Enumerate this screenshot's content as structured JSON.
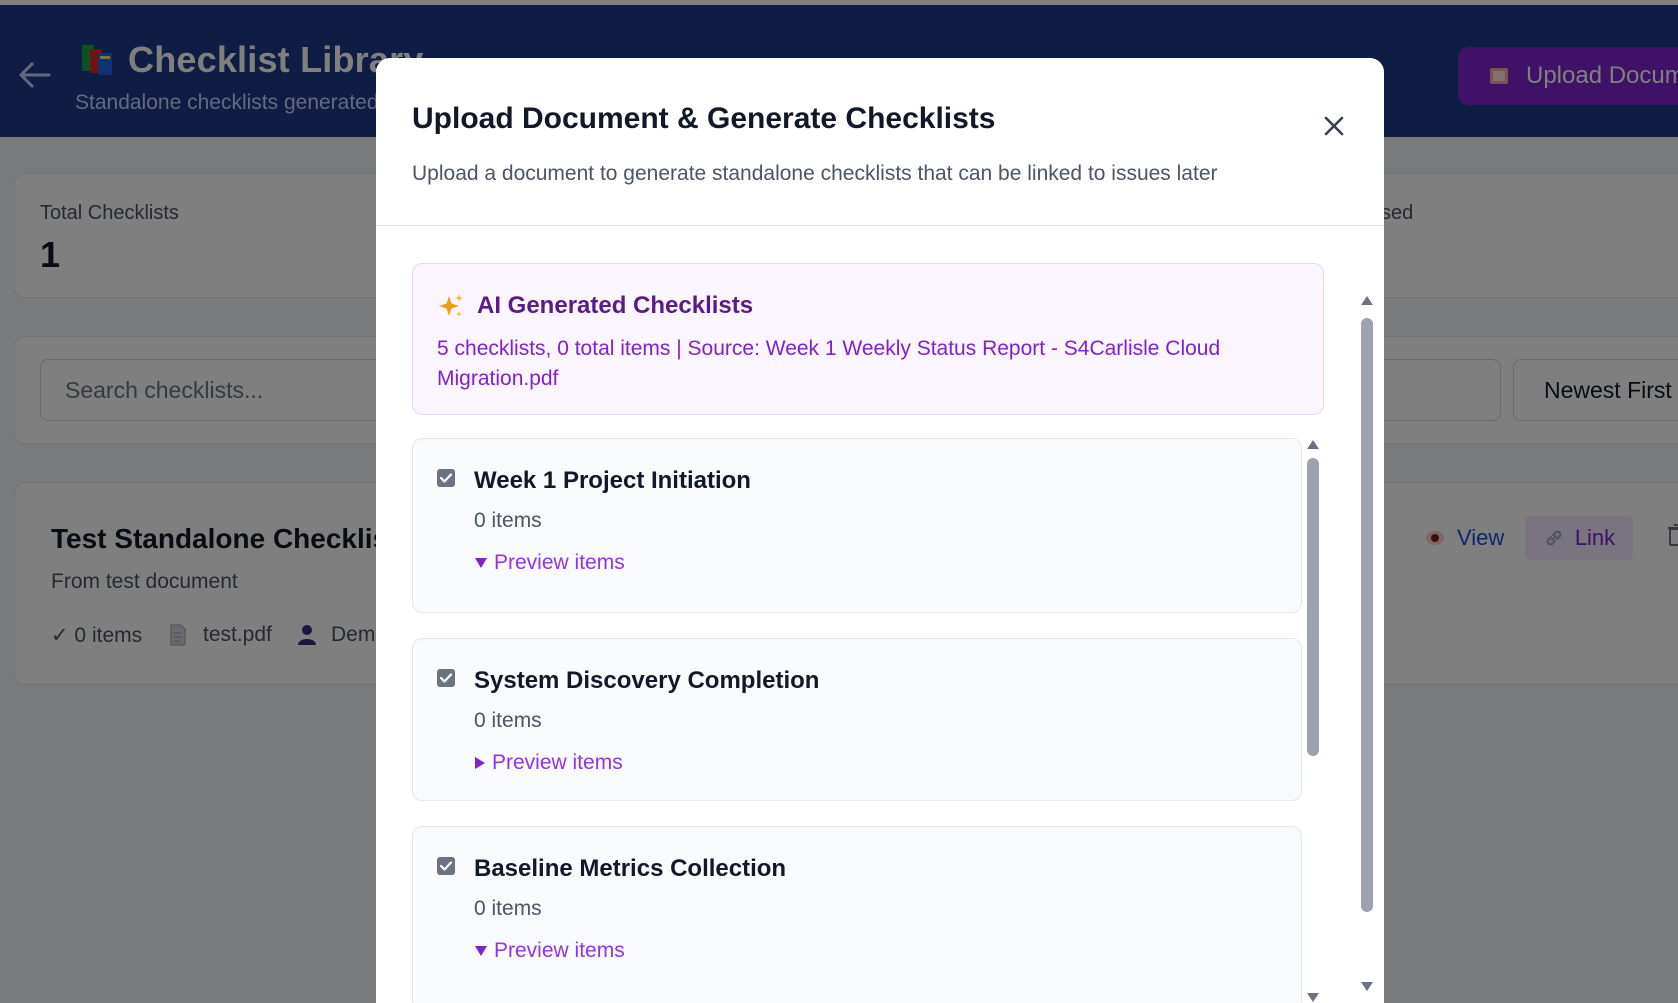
{
  "page": {
    "back_icon": "arrow-left-icon",
    "app_icon": "books-icon",
    "title": "Checklist Library",
    "subtitle": "Standalone checklists generated",
    "upload_button": {
      "icon": "book-icon",
      "label": "Upload Docum"
    },
    "stats": [
      {
        "label": "Total Checklists",
        "value": "1"
      },
      {
        "label": "sed",
        "value": ""
      }
    ],
    "search": {
      "placeholder": "Search checklists..."
    },
    "sort": {
      "selected": "Newest First"
    },
    "checklist_card": {
      "title": "Test Standalone Checklist",
      "description": "From test document",
      "items": "✓ 0 items",
      "file": "test.pdf",
      "owner": "Demo",
      "actions": {
        "view": "View",
        "link": "Link"
      }
    }
  },
  "modal": {
    "title": "Upload Document & Generate Checklists",
    "subtitle": "Upload a document to generate standalone checklists that can be linked to issues later",
    "ai_panel": {
      "title": "AI Generated Checklists",
      "summary": "5 checklists, 0 total items | Source: Week 1 Weekly Status Report - S4Carlisle Cloud Migration.pdf"
    },
    "checklists": [
      {
        "title": "Week 1 Project Initiation",
        "count": "0 items",
        "preview": "Preview items",
        "expanded": true,
        "checked": true
      },
      {
        "title": "System Discovery Completion",
        "count": "0 items",
        "preview": "Preview items",
        "expanded": false,
        "checked": true
      },
      {
        "title": "Baseline Metrics Collection",
        "count": "0 items",
        "preview": "Preview items",
        "expanded": true,
        "checked": true
      }
    ]
  },
  "colors": {
    "header": "#1e3a8a",
    "accent_purple": "#7e22ce",
    "link_purple": "#9333ea",
    "overlay": "rgba(0,0,0,0.5)"
  }
}
